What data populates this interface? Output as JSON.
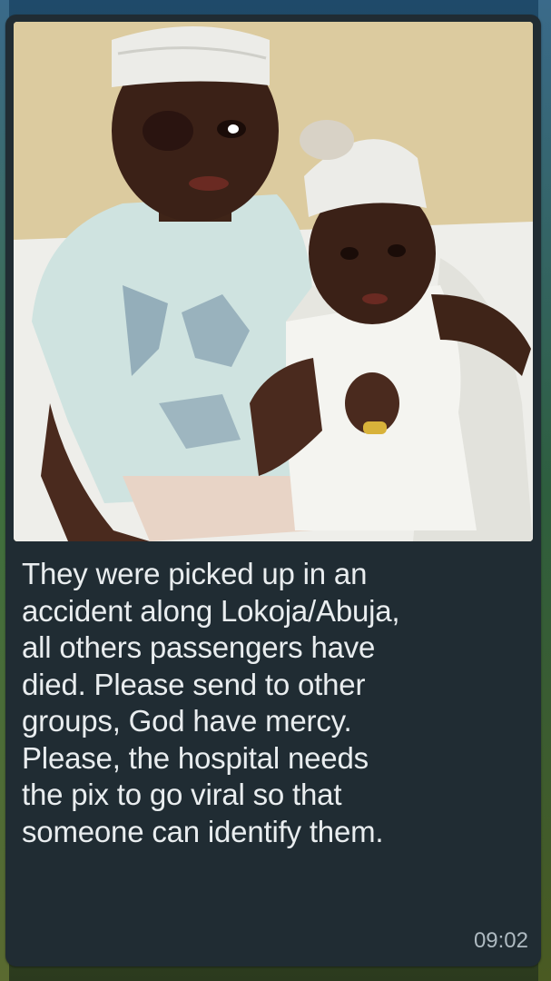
{
  "message": {
    "photo_alt": "",
    "caption_lines": [
      "They were picked up in an",
      "accident along Lokoja/Abuja,",
      "all others passengers have",
      "died. Please send to other",
      "groups, God have mercy.",
      "Please, the hospital needs",
      "the pix to go viral so that",
      "someone can identify them."
    ],
    "time": "09:02"
  },
  "colors": {
    "bubble": "#202c33",
    "text": "#e9edef",
    "timestamp": "#aebac1"
  }
}
